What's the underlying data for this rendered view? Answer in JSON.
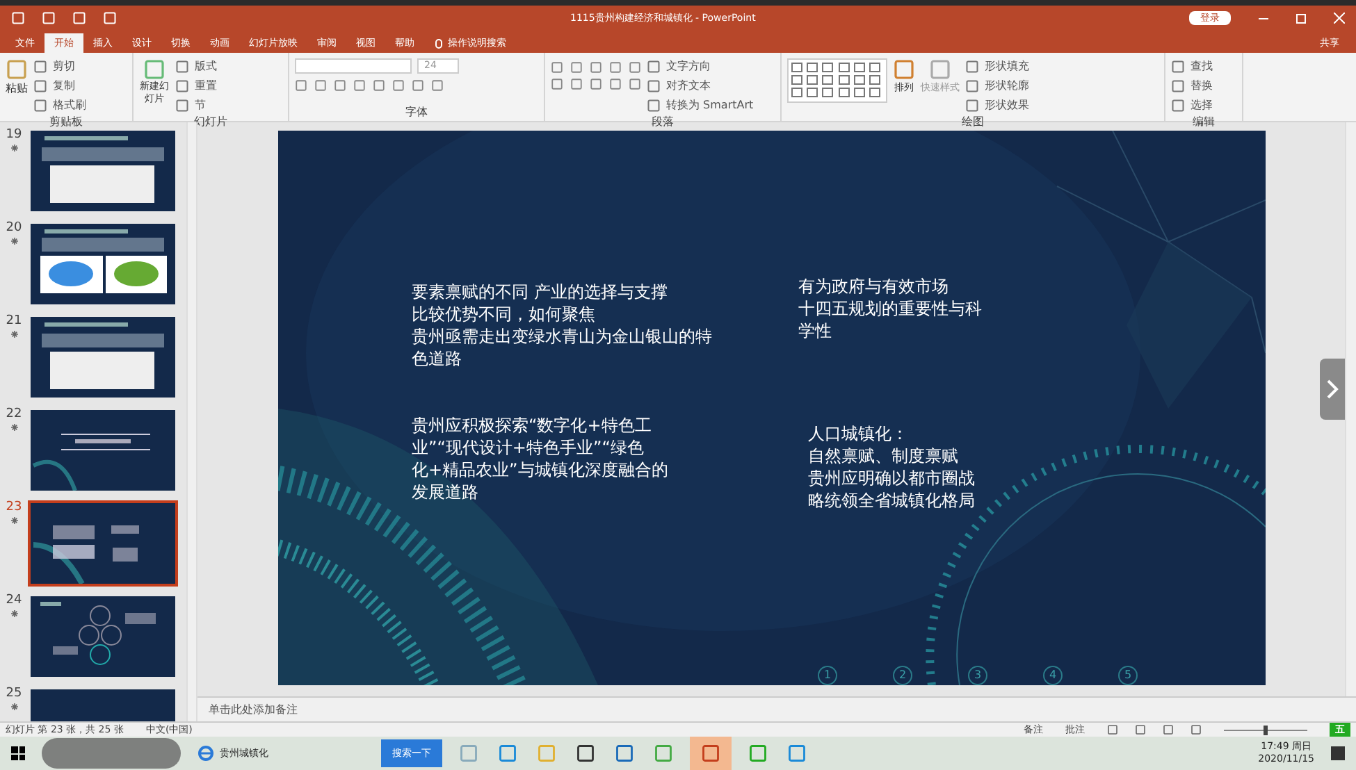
{
  "title_bar": {
    "title": "1115贵州构建经济和城镇化 - PowerPoint",
    "login": "登录"
  },
  "menu_tabs": [
    {
      "label": "文件",
      "selected": false
    },
    {
      "label": "开始",
      "selected": true
    },
    {
      "label": "插入",
      "selected": false
    },
    {
      "label": "设计",
      "selected": false
    },
    {
      "label": "切换",
      "selected": false
    },
    {
      "label": "动画",
      "selected": false
    },
    {
      "label": "幻灯片放映",
      "selected": false
    },
    {
      "label": "审阅",
      "selected": false
    },
    {
      "label": "视图",
      "selected": false
    },
    {
      "label": "帮助",
      "selected": false
    }
  ],
  "tell_me": "操作说明搜索",
  "share": "共享",
  "ribbon": {
    "clipboard": {
      "title": "剪贴板",
      "paste": "粘贴",
      "items": [
        "剪切",
        "复制",
        "格式刷"
      ]
    },
    "slides": {
      "title": "幻灯片",
      "new_slide": "新建幻灯片",
      "items": [
        "版式",
        "重置",
        "节"
      ]
    },
    "font": {
      "title": "字体",
      "size": "24"
    },
    "paragraph": {
      "title": "段落",
      "items": [
        "文字方向",
        "对齐文本",
        "转换为 SmartArt"
      ]
    },
    "drawing": {
      "title": "绘图",
      "arrange": "排列",
      "quick_styles": "快速样式",
      "items": [
        "形状填充",
        "形状轮廓",
        "形状效果"
      ]
    },
    "editing": {
      "title": "编辑",
      "items": [
        "查找",
        "替换",
        "选择"
      ]
    }
  },
  "thumbnails": [
    {
      "number": "19",
      "selected": false,
      "kind": "table"
    },
    {
      "number": "20",
      "selected": false,
      "kind": "map"
    },
    {
      "number": "21",
      "selected": false,
      "kind": "table"
    },
    {
      "number": "22",
      "selected": false,
      "kind": "section"
    },
    {
      "number": "23",
      "selected": true,
      "kind": "text"
    },
    {
      "number": "24",
      "selected": false,
      "kind": "diagram"
    },
    {
      "number": "25",
      "selected": false,
      "kind": "blank"
    }
  ],
  "slide": {
    "text_boxes": [
      {
        "lines": [
          "要素禀赋的不同   产业的选择与支撑",
          "比较优势不同，如何聚焦",
          "贵州亟需走出变绿水青山为金山银山的特",
          "色道路"
        ]
      },
      {
        "lines": [
          "有为政府与有效市场",
          "十四五规划的重要性与科",
          "学性"
        ]
      },
      {
        "lines": [
          "贵州应积极探索“数字化+特色工",
          "业”“现代设计+特色手业”“绿色",
          "化+精品农业”与城镇化深度融合的",
          "发展道路"
        ]
      },
      {
        "lines": [
          "人口城镇化：",
          "自然禀赋、制度禀赋",
          "贵州应明确以都市圈战",
          "略统领全省城镇化格局"
        ]
      }
    ],
    "step_numbers": [
      "1",
      "2",
      "3",
      "4",
      "5"
    ]
  },
  "notes": {
    "placeholder": "单击此处添加备注"
  },
  "status_bar": {
    "slide_info": "幻灯片 第 23 张，共 25 张",
    "language": "中文(中国)",
    "notes": "备注",
    "comments": "批注",
    "zoom": {
      "level": 0.5
    }
  },
  "taskbar": {
    "window_title": "贵州城镇化",
    "search": "搜索一下",
    "ime": "五",
    "time": "17:49 周日",
    "date": "2020/11/15"
  }
}
